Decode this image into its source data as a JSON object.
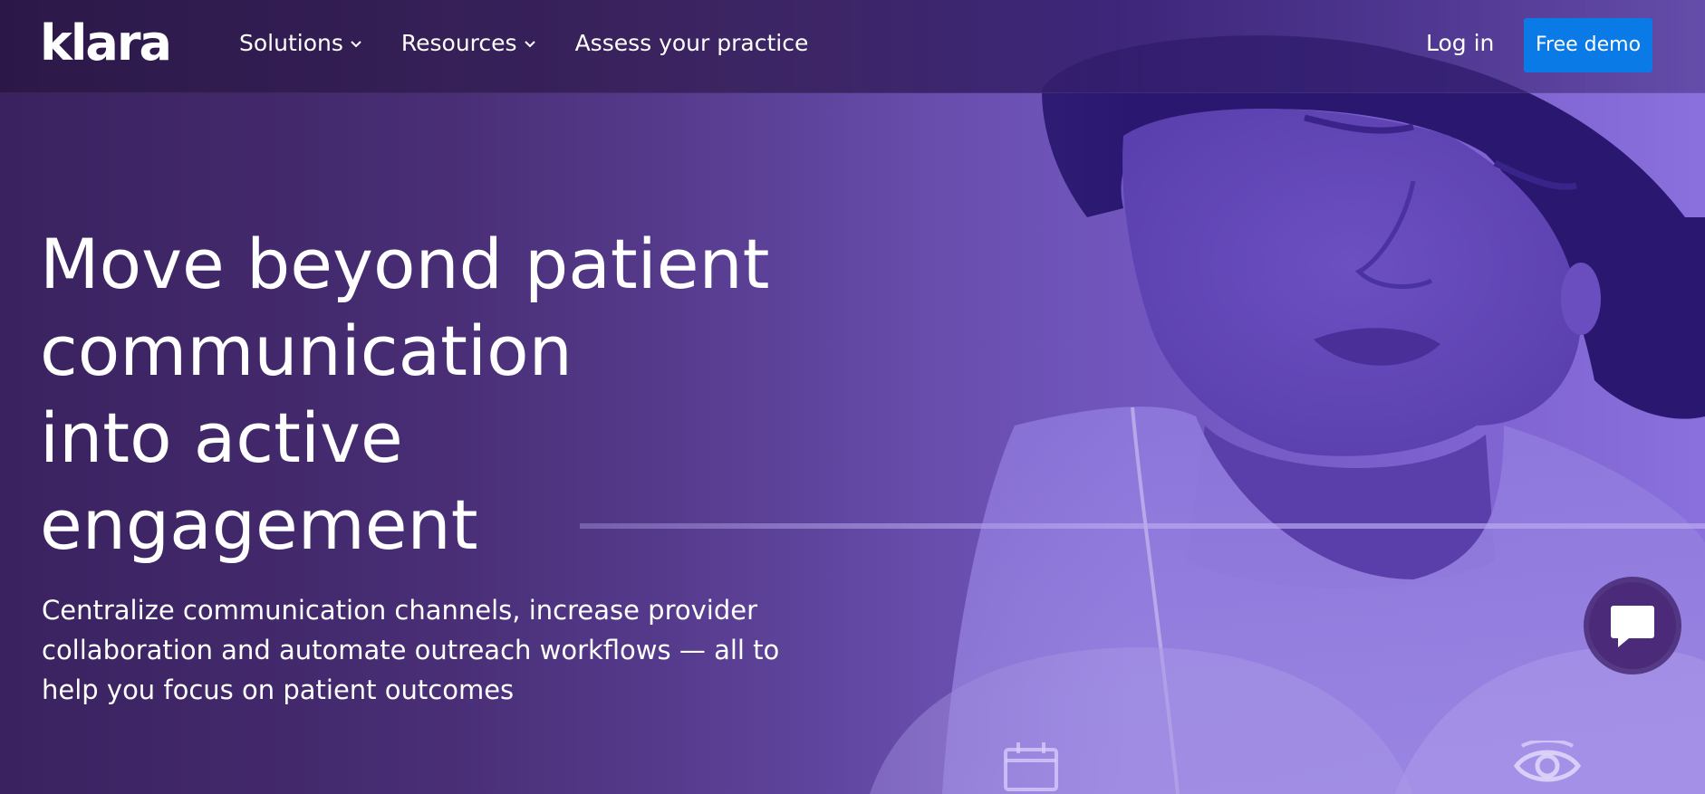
{
  "brand": {
    "logo_text": "klara"
  },
  "nav": {
    "items": [
      {
        "label": "Solutions",
        "has_dropdown": true,
        "icon": "chevron-down-icon"
      },
      {
        "label": "Resources",
        "has_dropdown": true,
        "icon": "chevron-down-icon"
      },
      {
        "label": "Assess your practice",
        "has_dropdown": false
      }
    ],
    "login_label": "Log in",
    "demo_label": "Free demo"
  },
  "hero": {
    "headline_lines": [
      "Move beyond patient",
      "communication",
      "into active",
      "engagement"
    ],
    "subtext_lines": [
      "Centralize communication channels, increase provider",
      "collaboration and automate outreach workflows — all to",
      "help you focus on patient outcomes"
    ],
    "icons": [
      "calendar-icon",
      "eye-icon"
    ]
  },
  "chat": {
    "icon": "chat-bubble-icon"
  },
  "colors": {
    "accent": "#0a7be6",
    "background": "#3a1f63",
    "text": "#ffffff"
  }
}
